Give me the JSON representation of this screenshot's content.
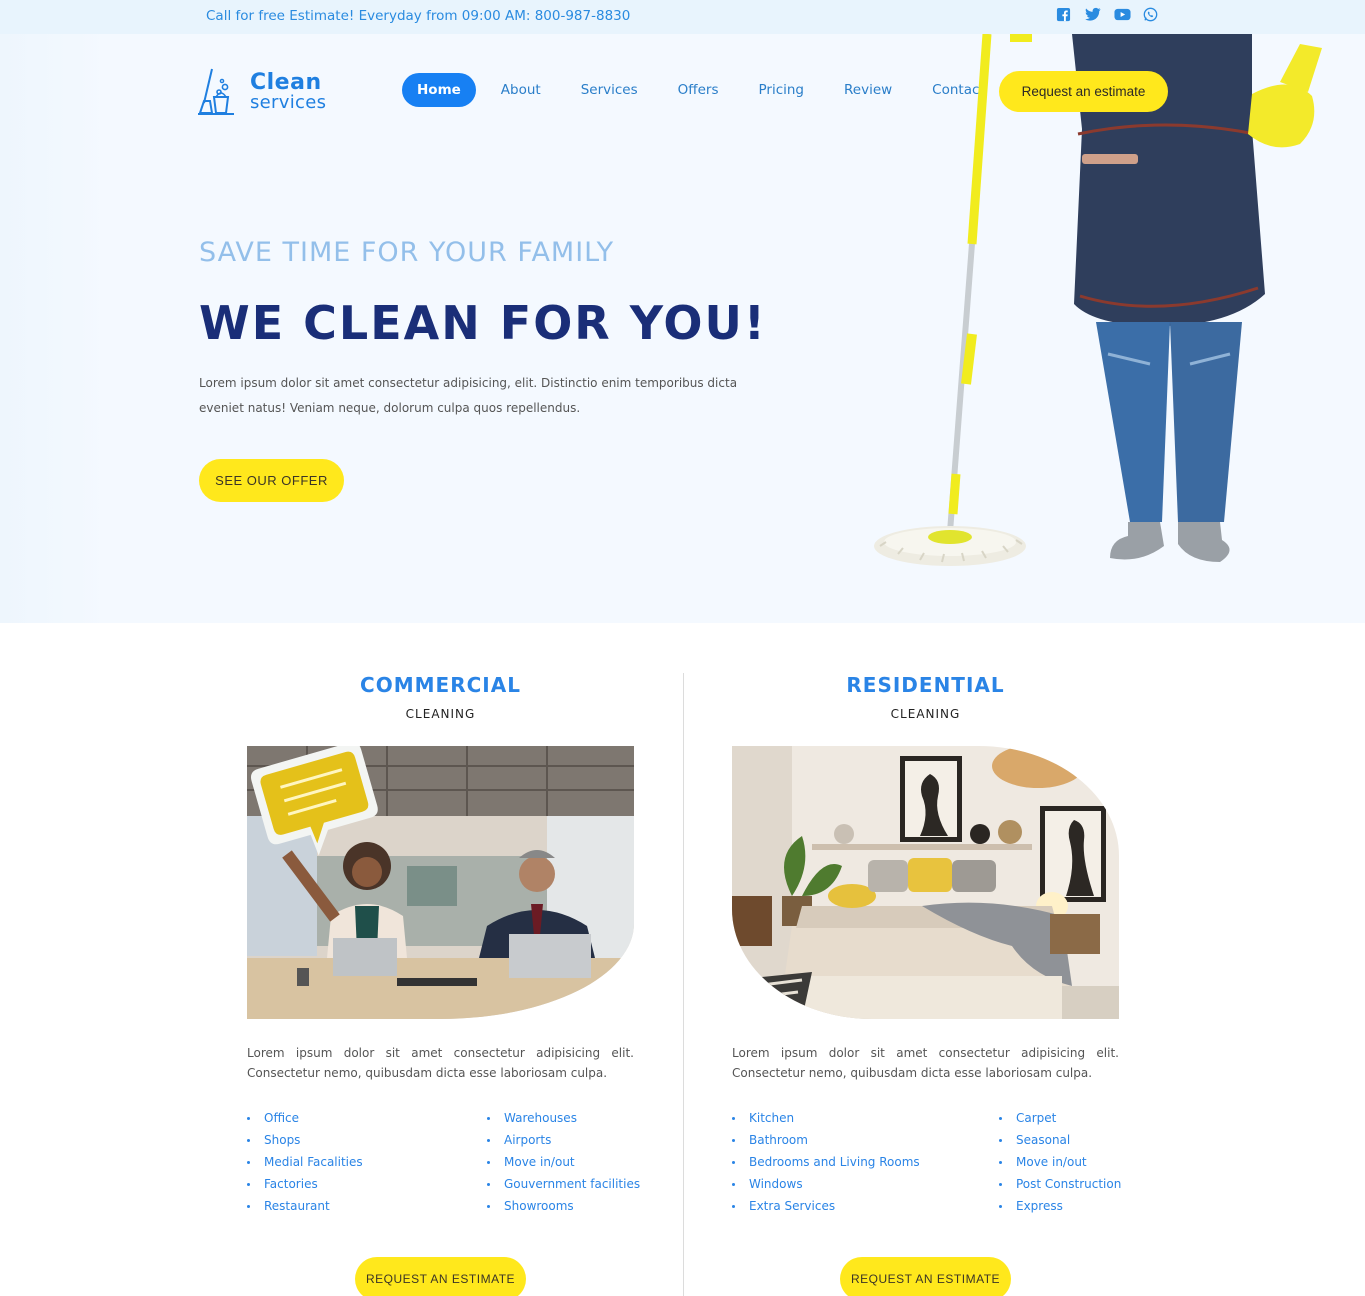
{
  "topbar": {
    "call_text": "Call for free Estimate! Everyday from 09:00 AM: 800-987-8830",
    "social": [
      "facebook-icon",
      "twitter-icon",
      "youtube-icon",
      "whatsapp-icon"
    ],
    "color": "#2a8be0"
  },
  "logo": {
    "line1": "Clean",
    "line2": "services"
  },
  "nav": {
    "items": [
      "Home",
      "About",
      "Services",
      "Offers",
      "Pricing",
      "Review",
      "Contact"
    ],
    "active": "Home",
    "cta": "Request an estimate"
  },
  "hero": {
    "kicker": "SAVE TIME FOR YOUR FAMILY",
    "headline": "WE CLEAN FOR YOU!",
    "lead": "Lorem ipsum dolor sit amet consectetur adipisicing, elit. Distinctio enim temporibus dicta eveniet natus! Veniam neque, dolorum culpa quos repellendus.",
    "button": "SEE OUR OFFER"
  },
  "commercial": {
    "title": "COMMERCIAL",
    "subtitle": "CLEANING",
    "desc": "Lorem ipsum dolor sit amet consectetur adipisicing elit. Consectetur nemo, quibusdam dicta esse laboriosam culpa.",
    "list_a": [
      "Office",
      "Shops",
      "Medial Facalities",
      "Factories",
      "Restaurant"
    ],
    "list_b": [
      "Warehouses",
      "Airports",
      "Move in/out",
      "Gouvernment facilities",
      "Showrooms"
    ],
    "button": "REQUEST AN ESTIMATE"
  },
  "residential": {
    "title": "RESIDENTIAL",
    "subtitle": "CLEANING",
    "desc": "Lorem ipsum dolor sit amet consectetur adipisicing elit. Consectetur nemo, quibusdam dicta esse laboriosam culpa.",
    "list_a": [
      "Kitchen",
      "Bathroom",
      "Bedrooms and Living Rooms",
      "Windows",
      "Extra Services"
    ],
    "list_b": [
      "Carpet",
      "Seasonal",
      "Move in/out",
      "Post Construction",
      "Express"
    ],
    "button": "REQUEST AN ESTIMATE"
  },
  "colors": {
    "accent_blue": "#1780f3",
    "yellow": "#ffe81c",
    "navy": "#1a2e78"
  }
}
